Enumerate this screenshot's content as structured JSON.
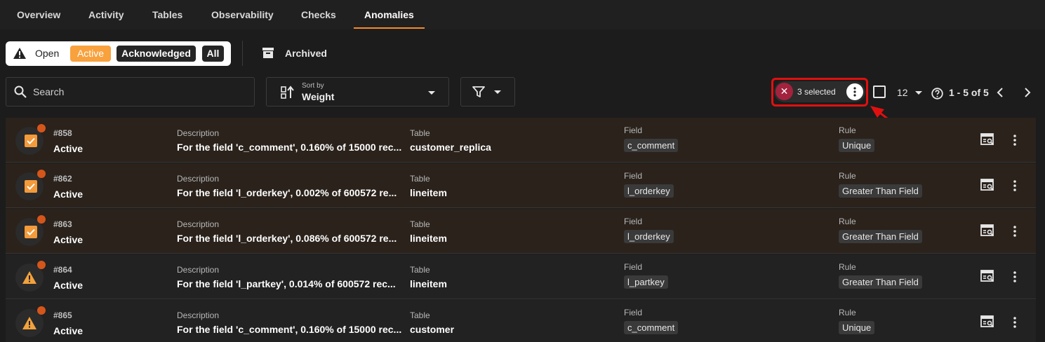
{
  "tabs": [
    {
      "label": "Overview"
    },
    {
      "label": "Activity"
    },
    {
      "label": "Tables"
    },
    {
      "label": "Observability"
    },
    {
      "label": "Checks"
    },
    {
      "label": "Anomalies",
      "active": true
    }
  ],
  "status_filter": {
    "icon": "warning-icon",
    "options": [
      "Open",
      "Active",
      "Acknowledged",
      "All"
    ],
    "selected": "Active"
  },
  "archived": {
    "icon": "archive-icon",
    "label": "Archived"
  },
  "search": {
    "placeholder": "Search",
    "value": ""
  },
  "sort": {
    "caption": "Sort by",
    "value": "Weight"
  },
  "filter": {
    "icon": "filter-icon"
  },
  "selection": {
    "count_label": "3 selected"
  },
  "pagination": {
    "per_page": "12",
    "range": "1 - 5 of 5"
  },
  "colors": {
    "accent": "#f58a2a",
    "selected_row": "#2a221b",
    "row": "#222222",
    "highlight": "#e01010"
  },
  "rows": [
    {
      "id": "#858",
      "status": "Active",
      "selected": true,
      "desc_caption": "Description",
      "description": "For the field 'c_comment', 0.160% of 15000 rec...",
      "table_caption": "Table",
      "table": "customer_replica",
      "field_caption": "Field",
      "field": "c_comment",
      "rule_caption": "Rule",
      "rule": "Unique"
    },
    {
      "id": "#862",
      "status": "Active",
      "selected": true,
      "desc_caption": "Description",
      "description": "For the field 'l_orderkey', 0.002% of 600572 re...",
      "table_caption": "Table",
      "table": "lineitem",
      "field_caption": "Field",
      "field": "l_orderkey",
      "rule_caption": "Rule",
      "rule": "Greater Than Field"
    },
    {
      "id": "#863",
      "status": "Active",
      "selected": true,
      "desc_caption": "Description",
      "description": "For the field 'l_orderkey', 0.086% of 600572 re...",
      "table_caption": "Table",
      "table": "lineitem",
      "field_caption": "Field",
      "field": "l_orderkey",
      "rule_caption": "Rule",
      "rule": "Greater Than Field"
    },
    {
      "id": "#864",
      "status": "Active",
      "selected": false,
      "desc_caption": "Description",
      "description": "For the field 'l_partkey', 0.014% of 600572 rec...",
      "table_caption": "Table",
      "table": "lineitem",
      "field_caption": "Field",
      "field": "l_partkey",
      "rule_caption": "Rule",
      "rule": "Greater Than Field"
    },
    {
      "id": "#865",
      "status": "Active",
      "selected": false,
      "desc_caption": "Description",
      "description": "For the field 'c_comment', 0.160% of 15000 rec...",
      "table_caption": "Table",
      "table": "customer",
      "field_caption": "Field",
      "field": "c_comment",
      "rule_caption": "Rule",
      "rule": "Unique"
    }
  ]
}
